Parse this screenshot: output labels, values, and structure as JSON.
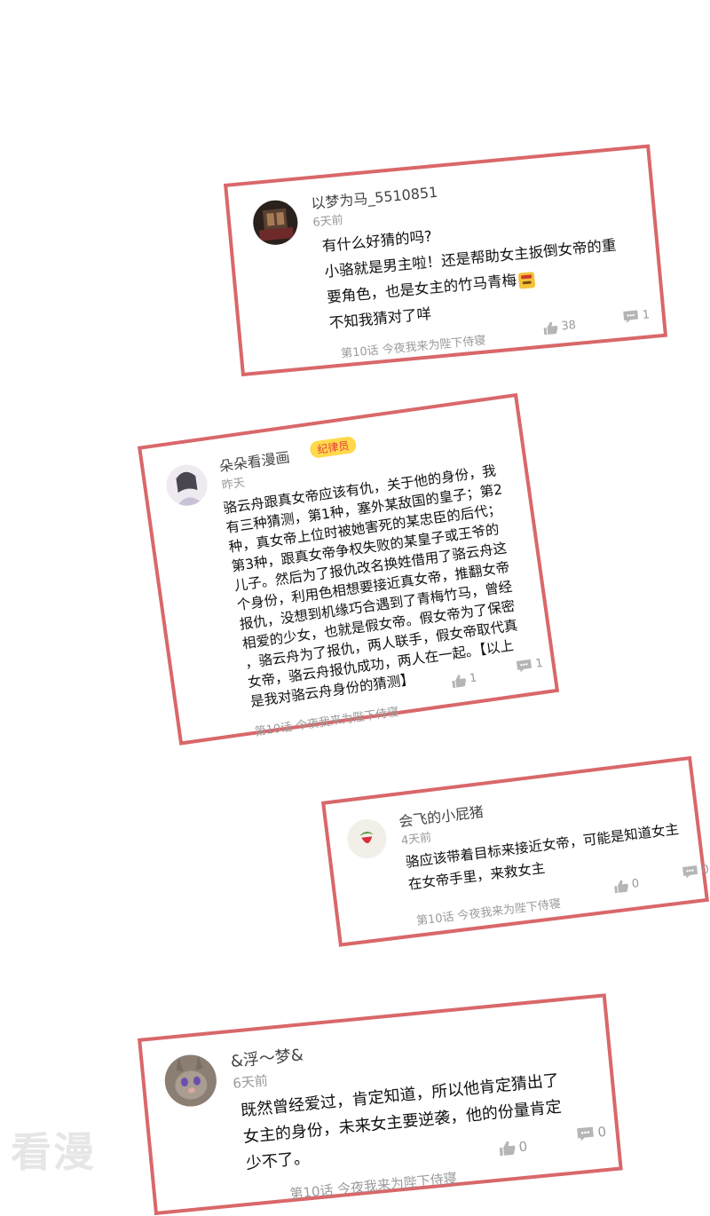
{
  "watermark": "看漫",
  "comments": [
    {
      "username": "以梦为马_5510851",
      "time": "6天前",
      "lines": [
        "有什么好猜的吗?",
        "小骆就是男主啦！还是帮助女主扳倒女帝的重",
        "要角色，也是女主的竹马青梅",
        "不知我猜对了咩"
      ],
      "likes": "38",
      "replies": "1",
      "chapter": "第10话 今夜我来为陛下侍寝"
    },
    {
      "username": "朵朵看漫画",
      "badge": "纪律员",
      "time": "昨天",
      "lines": [
        "骆云舟跟真女帝应该有仇，关于他的身份，我",
        "有三种猜测，第1种，塞外某敌国的皇子；第2",
        "种，真女帝上位时被她害死的某忠臣的后代；",
        "第3种，跟真女帝争权失败的某皇子或王爷的",
        "儿子。然后为了报仇改名换姓借用了骆云舟这",
        "个身份，利用色相想要接近真女帝，推翻女帝",
        "报仇，没想到机缘巧合遇到了青梅竹马，曾经",
        "相爱的少女，也就是假女帝。假女帝为了保密",
        "，骆云舟为了报仇，两人联手，假女帝取代真",
        "女帝，骆云舟报仇成功，两人在一起。【以上",
        "是我对骆云舟身份的猜测】"
      ],
      "likes": "1",
      "replies": "1",
      "chapter": "第10话 今夜我来为陛下侍寝"
    },
    {
      "username": "会飞的小屁猪",
      "time": "4天前",
      "lines": [
        "骆应该带着目标来接近女帝，可能是知道女主",
        "在女帝手里，来救女主"
      ],
      "likes": "0",
      "replies": "0",
      "chapter": "第10话 今夜我来为陛下侍寝"
    },
    {
      "username": "&浮～梦&",
      "time": "6天前",
      "lines": [
        "既然曾经爱过，肯定知道，所以他肯定猜出了",
        "女主的身份，未来女主要逆袭，他的份量肯定",
        "少不了。"
      ],
      "likes": "0",
      "replies": "0",
      "chapter": "第10话 今夜我来为陛下侍寝"
    }
  ]
}
